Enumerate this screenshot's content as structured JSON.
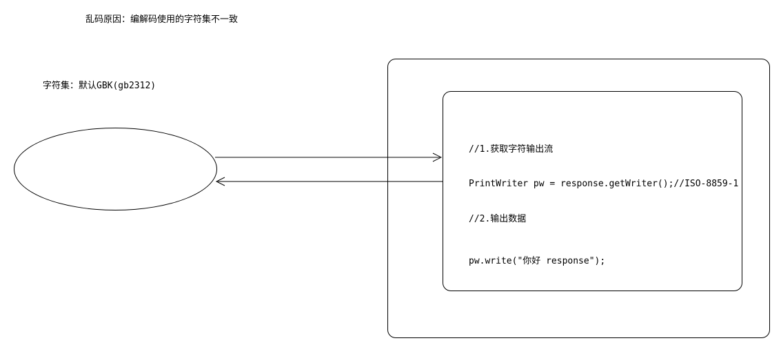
{
  "title": "乱码原因：编解码使用的字符集不一致",
  "charset_label": "字符集：默认GBK(gb2312)",
  "code": {
    "line1": "//1.获取字符输出流",
    "line2": "PrintWriter pw = response.getWriter();//ISO-8859-1",
    "line3": "//2.输出数据",
    "line4": "pw.write(\"你好 response\");"
  }
}
